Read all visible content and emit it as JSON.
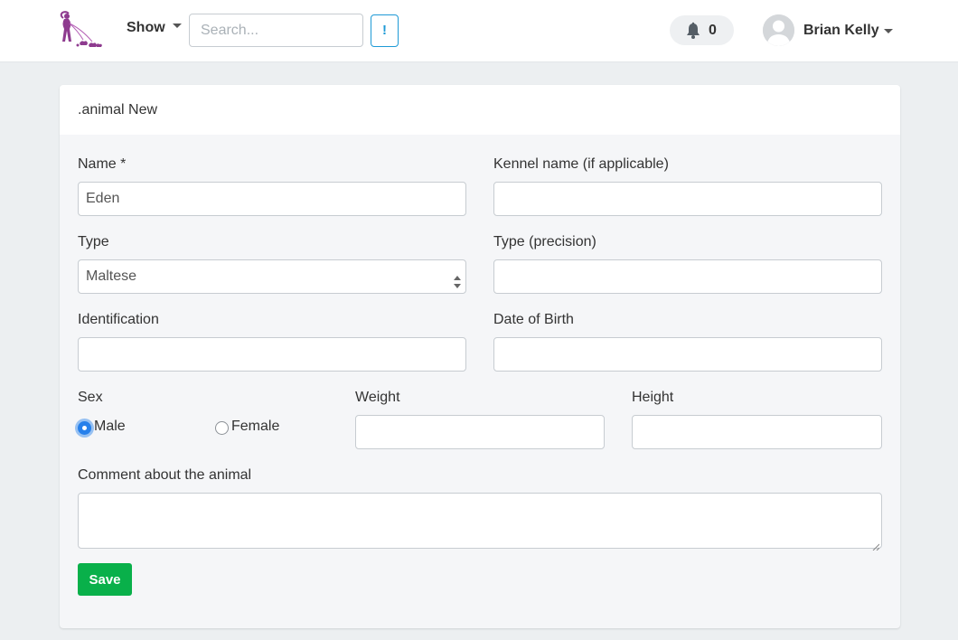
{
  "navbar": {
    "logo_icon": "dog-walker-logo-icon",
    "show_label": "Show",
    "search_placeholder": "Search...",
    "alert_button_label": "!",
    "notifications": {
      "icon": "bell-icon",
      "count": "0"
    },
    "user": {
      "name": "Brian Kelly",
      "avatar_icon": "user-avatar-icon"
    }
  },
  "card": {
    "title": ".animal New"
  },
  "form": {
    "name_label": "Name *",
    "name_value": "Eden",
    "kennel_label": "Kennel name (if applicable)",
    "kennel_value": "",
    "type_label": "Type",
    "type_selected": "Maltese",
    "type_precision_label": "Type (precision)",
    "type_precision_value": "",
    "identification_label": "Identification",
    "identification_value": "",
    "dob_label": "Date of Birth",
    "dob_value": "",
    "sex_label": "Sex",
    "sex_options": [
      {
        "label": "Male",
        "checked": true
      },
      {
        "label": "Female",
        "checked": false
      }
    ],
    "weight_label": "Weight",
    "weight_value": "",
    "height_label": "Height",
    "height_value": "",
    "comment_label": "Comment about the animal",
    "comment_value": "",
    "save_label": "Save"
  },
  "colors": {
    "accent": "#1e9ad6",
    "save_green": "#09b04a",
    "radio_blue": "#2680eb",
    "logo_purple": "#8e3b8f"
  }
}
